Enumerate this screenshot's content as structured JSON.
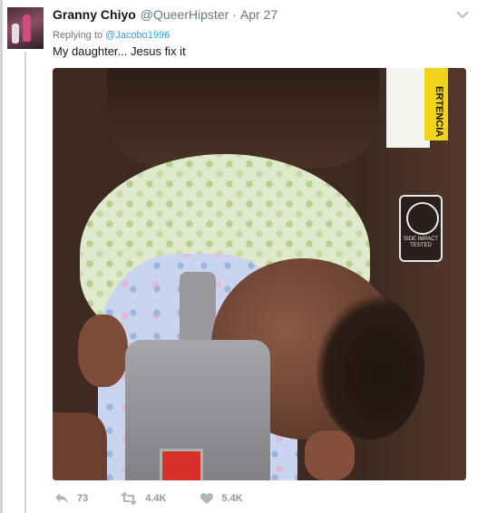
{
  "tweet": {
    "author_name": "Granny Chiyo",
    "handle": "@QueerHipster",
    "separator": "·",
    "date": "Apr 27",
    "replying_prefix": "Replying to",
    "replying_to": "@Jacobo1996",
    "text": "My daughter... Jesus fix it"
  },
  "media": {
    "sticker_text": "ERTENCIA",
    "badge_text": "SIDE IMPACT TESTED"
  },
  "actions": {
    "reply_count": "73",
    "retweet_count": "4.4K",
    "like_count": "5.4K"
  },
  "icons": {
    "caret": "chevron-down-icon",
    "reply": "reply-icon",
    "retweet": "retweet-icon",
    "like": "heart-icon"
  },
  "colors": {
    "link": "#1da1f2",
    "secondary_text": "#657786",
    "action_icon": "#aab8c2"
  }
}
